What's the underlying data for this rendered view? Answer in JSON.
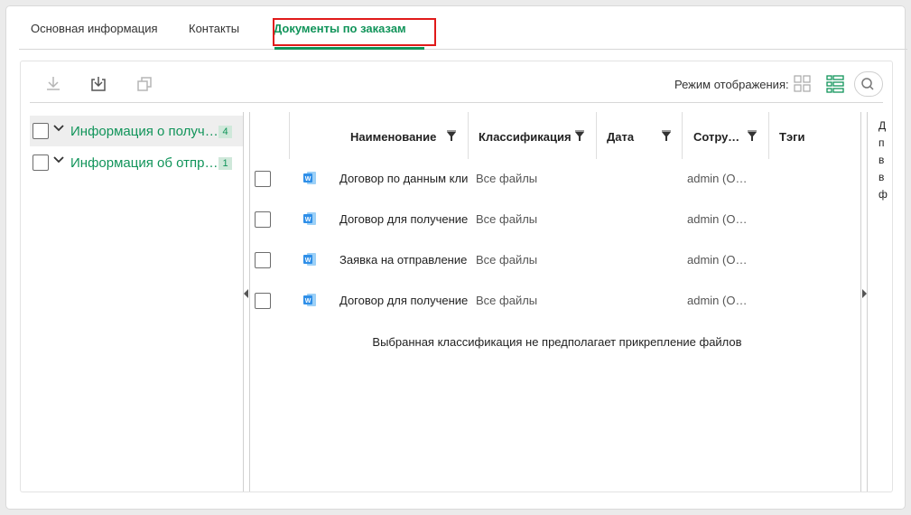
{
  "tabs": [
    {
      "label": "Основная информация"
    },
    {
      "label": "Контакты"
    },
    {
      "label": "Документы по заказам",
      "active": true
    }
  ],
  "toolbar": {
    "icons": [
      "download-icon",
      "download-to-box-icon",
      "copy-icon"
    ],
    "view_mode_label": "Режим отображения:",
    "view_icons": [
      "tiles-view-icon",
      "list-view-icon",
      "search-icon"
    ]
  },
  "tree": [
    {
      "label": "Информация о получателе",
      "count": "4",
      "selected": true
    },
    {
      "label": "Информация об отправителе",
      "count": "1",
      "selected": false
    }
  ],
  "grid": {
    "columns": [
      "Наименование",
      "Классификация",
      "Дата",
      "Сотрудник",
      "Тэги"
    ],
    "rows": [
      {
        "name": "Договор по данным клиента",
        "classification": "Все файлы",
        "date": "",
        "employee": "admin (О…",
        "tags": ""
      },
      {
        "name": "Договор для получение",
        "classification": "Все файлы",
        "date": "",
        "employee": "admin (О…",
        "tags": ""
      },
      {
        "name": "Заявка на отправление",
        "classification": "Все файлы",
        "date": "",
        "employee": "admin (О…",
        "tags": ""
      },
      {
        "name": "Договор для получение",
        "classification": "Все файлы",
        "date": "",
        "employee": "admin (О…",
        "tags": ""
      }
    ],
    "note": "Выбранная классификация не предполагает прикрепление файлов"
  },
  "side_panel": {
    "letters": [
      "Д",
      "п",
      "в",
      "в",
      "ф"
    ]
  },
  "colors": {
    "accent": "#11945a",
    "highlight_box": "#e01a1a",
    "word_icon": "#2f8fe8"
  }
}
